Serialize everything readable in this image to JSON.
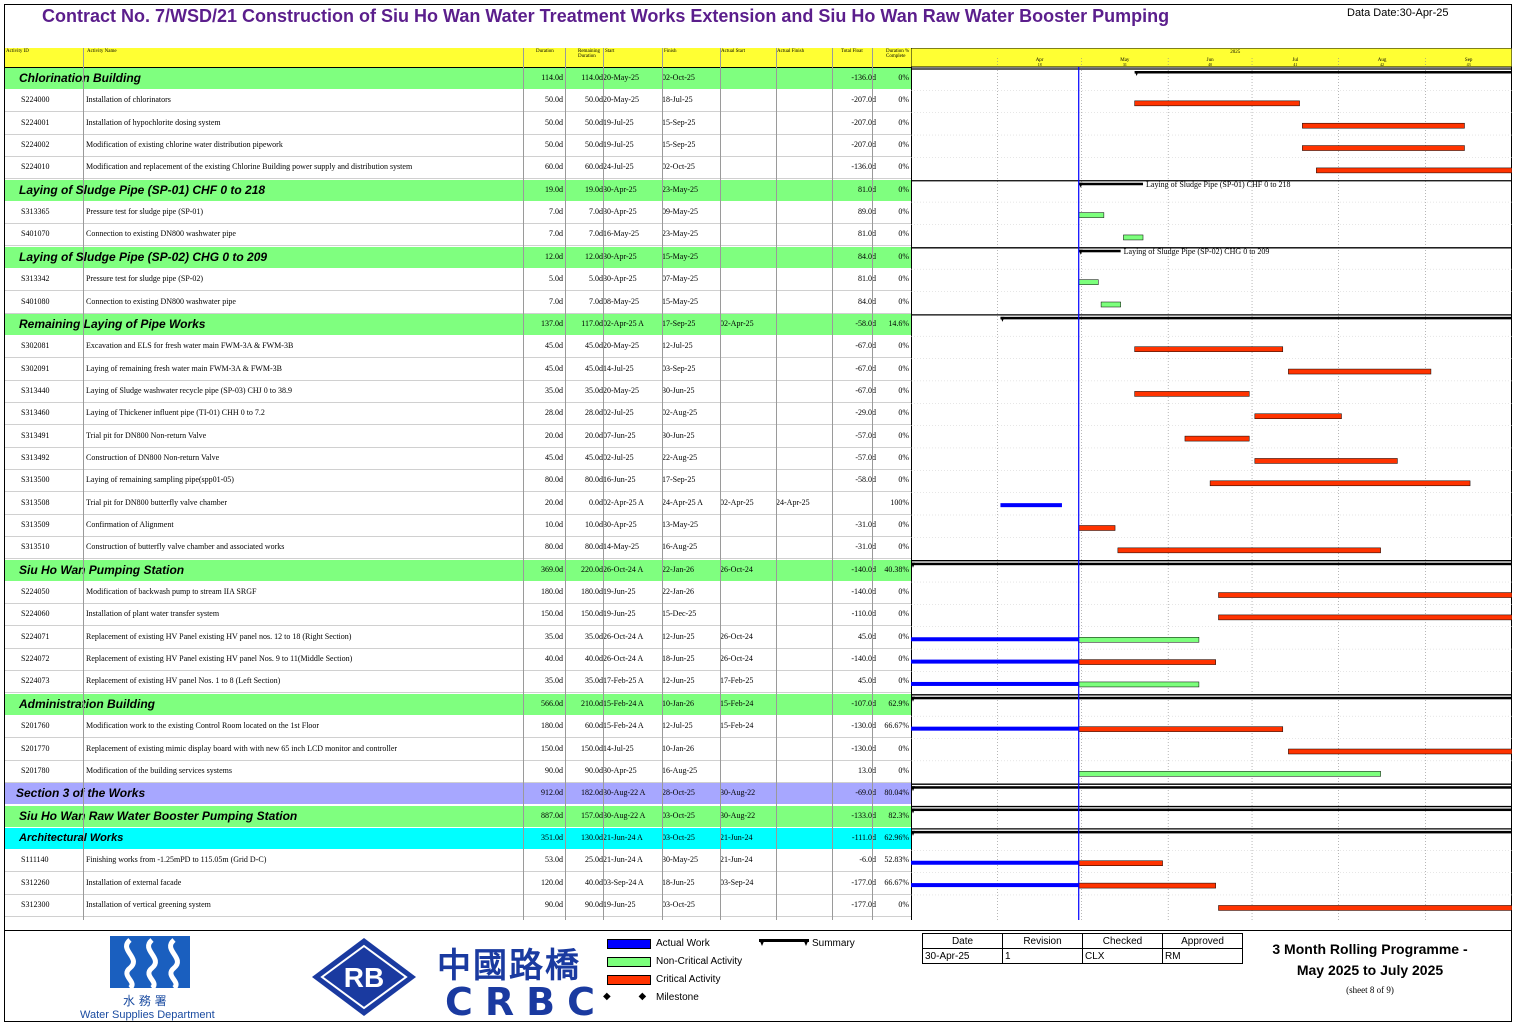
{
  "header": {
    "title": "Contract No. 7/WSD/21 Construction of Siu Ho Wan Water Treatment Works Extension and Siu Ho Wan Raw Water Booster Pumping",
    "data_date": "Data Date:30-Apr-25"
  },
  "columns": {
    "id": "Activity ID",
    "name": "Activity Name",
    "dur": "Duration",
    "rem": "Remaining Duration",
    "start": "Start",
    "finish": "Finish",
    "as": "Actual Start",
    "af": "Actual Finish",
    "tf": "Total Float",
    "pct": "Duration % Complete"
  },
  "timescale": {
    "year": "2025",
    "months": [
      "Apr",
      "May",
      "Jun",
      "Jul",
      "Aug",
      "Sep"
    ],
    "weeks": [
      "18",
      "31",
      "40",
      "41",
      "42",
      "43"
    ]
  },
  "rows": [
    {
      "type": "sum",
      "name": "Chlorination Building",
      "dur": "114.0d",
      "rem": "114.0d",
      "start": "20-May-25",
      "finish": "02-Oct-25",
      "as": "",
      "af": "",
      "tf": "-136.0d",
      "pct": "0%",
      "bars": [
        {
          "k": "summary",
          "s": "2025-05-20",
          "e": "2025-10-02"
        }
      ]
    },
    {
      "type": "act",
      "id": "S224000",
      "name": "Installation of chlorinators",
      "dur": "50.0d",
      "rem": "50.0d",
      "start": "20-May-25",
      "finish": "18-Jul-25",
      "as": "",
      "af": "",
      "tf": "-207.0d",
      "pct": "0%",
      "bars": [
        {
          "k": "critical",
          "s": "2025-05-20",
          "e": "2025-07-18"
        }
      ]
    },
    {
      "type": "act",
      "id": "S224001",
      "name": "Installation of hypochlorite dosing system",
      "dur": "50.0d",
      "rem": "50.0d",
      "start": "19-Jul-25",
      "finish": "15-Sep-25",
      "as": "",
      "af": "",
      "tf": "-207.0d",
      "pct": "0%",
      "bars": [
        {
          "k": "critical",
          "s": "2025-07-19",
          "e": "2025-09-15"
        }
      ]
    },
    {
      "type": "act",
      "id": "S224002",
      "name": "Modification of existing chlorine water distribution pipework",
      "dur": "50.0d",
      "rem": "50.0d",
      "start": "19-Jul-25",
      "finish": "15-Sep-25",
      "as": "",
      "af": "",
      "tf": "-207.0d",
      "pct": "0%",
      "bars": [
        {
          "k": "critical",
          "s": "2025-07-19",
          "e": "2025-09-15"
        }
      ]
    },
    {
      "type": "act",
      "id": "S224010",
      "name": "Modification and replacement of the existing Chlorine Building power supply and distribution system",
      "dur": "60.0d",
      "rem": "60.0d",
      "start": "24-Jul-25",
      "finish": "02-Oct-25",
      "as": "",
      "af": "",
      "tf": "-136.0d",
      "pct": "0%",
      "bars": [
        {
          "k": "critical",
          "s": "2025-07-24",
          "e": "2025-10-02"
        }
      ]
    },
    {
      "type": "sum",
      "name": "Laying of Sludge Pipe (SP-01) CHF 0  to 218",
      "dur": "19.0d",
      "rem": "19.0d",
      "start": "30-Apr-25",
      "finish": "23-May-25",
      "as": "",
      "af": "",
      "tf": "81.0d",
      "pct": "0%",
      "label": "Laying of Sludge Pipe (SP-01) CHF 0  to 218",
      "bars": [
        {
          "k": "summary",
          "s": "2025-04-30",
          "e": "2025-05-23"
        }
      ]
    },
    {
      "type": "act",
      "id": "S313365",
      "name": "Pressure test for sludge pipe (SP-01)",
      "dur": "7.0d",
      "rem": "7.0d",
      "start": "30-Apr-25",
      "finish": "09-May-25",
      "as": "",
      "af": "",
      "tf": "89.0d",
      "pct": "0%",
      "bars": [
        {
          "k": "noncritical",
          "s": "2025-04-30",
          "e": "2025-05-09"
        }
      ]
    },
    {
      "type": "act",
      "id": "S401070",
      "name": "Connection to existing DN800 washwater pipe",
      "dur": "7.0d",
      "rem": "7.0d",
      "start": "16-May-25",
      "finish": "23-May-25",
      "as": "",
      "af": "",
      "tf": "81.0d",
      "pct": "0%",
      "bars": [
        {
          "k": "noncritical",
          "s": "2025-05-16",
          "e": "2025-05-23"
        }
      ]
    },
    {
      "type": "sum",
      "name": "Laying of Sludge Pipe (SP-02) CHG 0  to 209",
      "dur": "12.0d",
      "rem": "12.0d",
      "start": "30-Apr-25",
      "finish": "15-May-25",
      "as": "",
      "af": "",
      "tf": "84.0d",
      "pct": "0%",
      "label": "Laying of Sludge Pipe (SP-02) CHG 0  to 209",
      "bars": [
        {
          "k": "summary",
          "s": "2025-04-30",
          "e": "2025-05-15"
        }
      ]
    },
    {
      "type": "act",
      "id": "S313342",
      "name": "Pressure test for sludge pipe (SP-02)",
      "dur": "5.0d",
      "rem": "5.0d",
      "start": "30-Apr-25",
      "finish": "07-May-25",
      "as": "",
      "af": "",
      "tf": "81.0d",
      "pct": "0%",
      "bars": [
        {
          "k": "noncritical",
          "s": "2025-04-30",
          "e": "2025-05-07"
        }
      ]
    },
    {
      "type": "act",
      "id": "S401080",
      "name": "Connection to existing DN800 washwater pipe",
      "dur": "7.0d",
      "rem": "7.0d",
      "start": "08-May-25",
      "finish": "15-May-25",
      "as": "",
      "af": "",
      "tf": "84.0d",
      "pct": "0%",
      "bars": [
        {
          "k": "noncritical",
          "s": "2025-05-08",
          "e": "2025-05-15"
        }
      ]
    },
    {
      "type": "sum",
      "name": "Remaining Laying of Pipe Works",
      "dur": "137.0d",
      "rem": "117.0d",
      "start": "02-Apr-25 A",
      "finish": "17-Sep-25",
      "as": "02-Apr-25",
      "af": "",
      "tf": "-58.0d",
      "pct": "14.6%",
      "bars": [
        {
          "k": "summary",
          "s": "2025-04-02",
          "e": "2025-10-02"
        }
      ]
    },
    {
      "type": "act",
      "id": "S302081",
      "name": "Excavation and ELS for fresh water main FWM-3A & FWM-3B",
      "dur": "45.0d",
      "rem": "45.0d",
      "start": "20-May-25",
      "finish": "12-Jul-25",
      "as": "",
      "af": "",
      "tf": "-67.0d",
      "pct": "0%",
      "bars": [
        {
          "k": "critical",
          "s": "2025-05-20",
          "e": "2025-07-12"
        }
      ]
    },
    {
      "type": "act",
      "id": "S302091",
      "name": "Laying of remaining fresh water main FWM-3A & FWM-3B",
      "dur": "45.0d",
      "rem": "45.0d",
      "start": "14-Jul-25",
      "finish": "03-Sep-25",
      "as": "",
      "af": "",
      "tf": "-67.0d",
      "pct": "0%",
      "bars": [
        {
          "k": "critical",
          "s": "2025-07-14",
          "e": "2025-09-03"
        }
      ]
    },
    {
      "type": "act",
      "id": "S313440",
      "name": "Laying of Sludge washwater recycle pipe (SP-03) CHJ 0 to 38.9",
      "dur": "35.0d",
      "rem": "35.0d",
      "start": "20-May-25",
      "finish": "30-Jun-25",
      "as": "",
      "af": "",
      "tf": "-67.0d",
      "pct": "0%",
      "bars": [
        {
          "k": "critical",
          "s": "2025-05-20",
          "e": "2025-06-30"
        }
      ]
    },
    {
      "type": "act",
      "id": "S313460",
      "name": "Laying of Thickener influent pipe (TI-01) CHH 0 to 7.2",
      "dur": "28.0d",
      "rem": "28.0d",
      "start": "02-Jul-25",
      "finish": "02-Aug-25",
      "as": "",
      "af": "",
      "tf": "-29.0d",
      "pct": "0%",
      "bars": [
        {
          "k": "critical",
          "s": "2025-07-02",
          "e": "2025-08-02"
        }
      ]
    },
    {
      "type": "act",
      "id": "S313491",
      "name": "Trial pit for DN800 Non-return Valve",
      "dur": "20.0d",
      "rem": "20.0d",
      "start": "07-Jun-25",
      "finish": "30-Jun-25",
      "as": "",
      "af": "",
      "tf": "-57.0d",
      "pct": "0%",
      "bars": [
        {
          "k": "critical",
          "s": "2025-06-07",
          "e": "2025-06-30"
        }
      ]
    },
    {
      "type": "act",
      "id": "S313492",
      "name": "Construction of DN800 Non-return Valve",
      "dur": "45.0d",
      "rem": "45.0d",
      "start": "02-Jul-25",
      "finish": "22-Aug-25",
      "as": "",
      "af": "",
      "tf": "-57.0d",
      "pct": "0%",
      "bars": [
        {
          "k": "critical",
          "s": "2025-07-02",
          "e": "2025-08-22"
        }
      ]
    },
    {
      "type": "act",
      "id": "S313500",
      "name": "Laying of remaining sampling pipe(spp01-05)",
      "dur": "80.0d",
      "rem": "80.0d",
      "start": "16-Jun-25",
      "finish": "17-Sep-25",
      "as": "",
      "af": "",
      "tf": "-58.0d",
      "pct": "0%",
      "bars": [
        {
          "k": "critical",
          "s": "2025-06-16",
          "e": "2025-09-17"
        }
      ]
    },
    {
      "type": "act",
      "id": "S313508",
      "name": "Trial pit for DN800 butterfly valve chamber",
      "dur": "20.0d",
      "rem": "0.0d",
      "start": "02-Apr-25 A",
      "finish": "24-Apr-25 A",
      "as": "02-Apr-25",
      "af": "24-Apr-25",
      "tf": "",
      "pct": "100%",
      "bars": [
        {
          "k": "actual",
          "s": "2025-04-02",
          "e": "2025-04-24"
        }
      ]
    },
    {
      "type": "act",
      "id": "S313509",
      "name": "Confirmation of Alignment",
      "dur": "10.0d",
      "rem": "10.0d",
      "start": "30-Apr-25",
      "finish": "13-May-25",
      "as": "",
      "af": "",
      "tf": "-31.0d",
      "pct": "0%",
      "bars": [
        {
          "k": "critical",
          "s": "2025-04-30",
          "e": "2025-05-13"
        }
      ]
    },
    {
      "type": "act",
      "id": "S313510",
      "name": "Construction of butterfly valve chamber and associated works",
      "dur": "80.0d",
      "rem": "80.0d",
      "start": "14-May-25",
      "finish": "16-Aug-25",
      "as": "",
      "af": "",
      "tf": "-31.0d",
      "pct": "0%",
      "bars": [
        {
          "k": "critical",
          "s": "2025-05-14",
          "e": "2025-08-16"
        }
      ]
    },
    {
      "type": "sum",
      "name": "Siu Ho Wan Pumping Station",
      "dur": "369.0d",
      "rem": "220.0d",
      "start": "26-Oct-24 A",
      "finish": "22-Jan-26",
      "as": "26-Oct-24",
      "af": "",
      "tf": "-140.0d",
      "pct": "40.38%",
      "bars": [
        {
          "k": "summary",
          "s": "2025-03-01",
          "e": "2025-10-02"
        }
      ]
    },
    {
      "type": "act",
      "id": "S224050",
      "name": "Modification of backwash pump to stream IIA SRGF",
      "dur": "180.0d",
      "rem": "180.0d",
      "start": "19-Jun-25",
      "finish": "22-Jan-26",
      "as": "",
      "af": "",
      "tf": "-140.0d",
      "pct": "0%",
      "bars": [
        {
          "k": "critical",
          "s": "2025-06-19",
          "e": "2025-10-02"
        }
      ]
    },
    {
      "type": "act",
      "id": "S224060",
      "name": "Installation of plant water transfer system",
      "dur": "150.0d",
      "rem": "150.0d",
      "start": "19-Jun-25",
      "finish": "15-Dec-25",
      "as": "",
      "af": "",
      "tf": "-110.0d",
      "pct": "0%",
      "bars": [
        {
          "k": "critical",
          "s": "2025-06-19",
          "e": "2025-10-02"
        }
      ]
    },
    {
      "type": "act",
      "id": "S224071",
      "name": "Replacement of existing HV Panel existing HV panel nos. 12 to 18 (Right Section)",
      "dur": "35.0d",
      "rem": "35.0d",
      "start": "26-Oct-24 A",
      "finish": "12-Jun-25",
      "as": "26-Oct-24",
      "af": "",
      "tf": "45.0d",
      "pct": "0%",
      "bars": [
        {
          "k": "actual",
          "s": "2025-03-01",
          "e": "2025-04-30"
        },
        {
          "k": "noncritical",
          "s": "2025-04-30",
          "e": "2025-06-12"
        }
      ]
    },
    {
      "type": "act",
      "id": "S224072",
      "name": "Replacement of existing HV Panel existing HV panel Nos. 9 to 11(Middle Section)",
      "dur": "40.0d",
      "rem": "40.0d",
      "start": "26-Oct-24 A",
      "finish": "18-Jun-25",
      "as": "26-Oct-24",
      "af": "",
      "tf": "-140.0d",
      "pct": "0%",
      "bars": [
        {
          "k": "actual",
          "s": "2025-03-01",
          "e": "2025-04-30"
        },
        {
          "k": "critical",
          "s": "2025-04-30",
          "e": "2025-06-18"
        }
      ]
    },
    {
      "type": "act",
      "id": "S224073",
      "name": "Replacement of existing HV panel Nos. 1 to 8 (Left Section)",
      "dur": "35.0d",
      "rem": "35.0d",
      "start": "17-Feb-25 A",
      "finish": "12-Jun-25",
      "as": "17-Feb-25",
      "af": "",
      "tf": "45.0d",
      "pct": "0%",
      "bars": [
        {
          "k": "actual",
          "s": "2025-03-01",
          "e": "2025-04-30"
        },
        {
          "k": "noncritical",
          "s": "2025-04-30",
          "e": "2025-06-12"
        }
      ]
    },
    {
      "type": "sum",
      "name": "Administration Building",
      "dur": "566.0d",
      "rem": "210.0d",
      "start": "15-Feb-24 A",
      "finish": "10-Jan-26",
      "as": "15-Feb-24",
      "af": "",
      "tf": "-107.0d",
      "pct": "62.9%",
      "bars": [
        {
          "k": "summary",
          "s": "2025-03-01",
          "e": "2025-10-02"
        }
      ]
    },
    {
      "type": "act",
      "id": "S201760",
      "name": "Modification work to the existing Control Room located on the 1st Floor",
      "dur": "180.0d",
      "rem": "60.0d",
      "start": "15-Feb-24 A",
      "finish": "12-Jul-25",
      "as": "15-Feb-24",
      "af": "",
      "tf": "-130.0d",
      "pct": "66.67%",
      "bars": [
        {
          "k": "actual",
          "s": "2025-03-01",
          "e": "2025-04-30"
        },
        {
          "k": "critical",
          "s": "2025-04-30",
          "e": "2025-07-12"
        }
      ]
    },
    {
      "type": "act",
      "id": "S201770",
      "name": "Replacement of existing mimic display board with with new 65 inch LCD monitor and controller",
      "dur": "150.0d",
      "rem": "150.0d",
      "start": "14-Jul-25",
      "finish": "10-Jan-26",
      "as": "",
      "af": "",
      "tf": "-130.0d",
      "pct": "0%",
      "bars": [
        {
          "k": "critical",
          "s": "2025-07-14",
          "e": "2025-10-02"
        }
      ]
    },
    {
      "type": "act",
      "id": "S201780",
      "name": "Modification of the building services systems",
      "dur": "90.0d",
      "rem": "90.0d",
      "start": "30-Apr-25",
      "finish": "16-Aug-25",
      "as": "",
      "af": "",
      "tf": "13.0d",
      "pct": "0%",
      "bars": [
        {
          "k": "noncritical",
          "s": "2025-04-30",
          "e": "2025-08-16"
        }
      ]
    },
    {
      "type": "sec",
      "name": "Section 3 of the Works",
      "dur": "912.0d",
      "rem": "182.0d",
      "start": "30-Aug-22 A",
      "finish": "28-Oct-25",
      "as": "30-Aug-22",
      "af": "",
      "tf": "-69.0d",
      "pct": "80.04%",
      "bars": [
        {
          "k": "summary",
          "s": "2025-03-01",
          "e": "2025-10-02"
        }
      ]
    },
    {
      "type": "sum",
      "name": "Siu Ho Wan Raw Water Booster Pumping Station",
      "dur": "887.0d",
      "rem": "157.0d",
      "start": "30-Aug-22 A",
      "finish": "03-Oct-25",
      "as": "30-Aug-22",
      "af": "",
      "tf": "-133.0d",
      "pct": "82.3%",
      "bars": [
        {
          "k": "summary",
          "s": "2025-03-01",
          "e": "2025-10-02"
        }
      ]
    },
    {
      "type": "sub",
      "name": "Architectural Works",
      "dur": "351.0d",
      "rem": "130.0d",
      "start": "21-Jun-24 A",
      "finish": "03-Oct-25",
      "as": "21-Jun-24",
      "af": "",
      "tf": "-111.0d",
      "pct": "62.96%",
      "bars": [
        {
          "k": "summary",
          "s": "2025-03-01",
          "e": "2025-10-02"
        }
      ]
    },
    {
      "type": "act",
      "id": "S111140",
      "name": "Finishing works from -1.25mPD to 115.05m (Grid D-C)",
      "dur": "53.0d",
      "rem": "25.0d",
      "start": "21-Jun-24 A",
      "finish": "30-May-25",
      "as": "21-Jun-24",
      "af": "",
      "tf": "-6.0d",
      "pct": "52.83%",
      "bars": [
        {
          "k": "actual",
          "s": "2025-03-01",
          "e": "2025-04-30"
        },
        {
          "k": "critical",
          "s": "2025-04-30",
          "e": "2025-05-30"
        }
      ]
    },
    {
      "type": "act",
      "id": "S312260",
      "name": "Installation of external facade",
      "dur": "120.0d",
      "rem": "40.0d",
      "start": "03-Sep-24 A",
      "finish": "18-Jun-25",
      "as": "03-Sep-24",
      "af": "",
      "tf": "-177.0d",
      "pct": "66.67%",
      "bars": [
        {
          "k": "actual",
          "s": "2025-03-01",
          "e": "2025-04-30"
        },
        {
          "k": "critical",
          "s": "2025-04-30",
          "e": "2025-06-18"
        }
      ]
    },
    {
      "type": "act",
      "id": "S312300",
      "name": "Installation of vertical greening system",
      "dur": "90.0d",
      "rem": "90.0d",
      "start": "19-Jun-25",
      "finish": "03-Oct-25",
      "as": "",
      "af": "",
      "tf": "-177.0d",
      "pct": "0%",
      "bars": [
        {
          "k": "critical",
          "s": "2025-06-19",
          "e": "2025-10-02"
        }
      ]
    }
  ],
  "colors": {
    "summary_row": "#7fff7f",
    "section_row": "#a7a7ff",
    "subsection_row": "#00ffff",
    "header_yellow": "#ffff33",
    "actual": "#0000ff",
    "noncritical": "#7cff7c",
    "critical": "#ff3300",
    "data_date_line": "#0000ff",
    "title": "#5b1e8c"
  },
  "legend": {
    "actual": "Actual Work",
    "noncritical": "Non-Critical Activity",
    "critical": "Critical Activity",
    "milestone": "Milestone",
    "summary": "Summary"
  },
  "signoff": {
    "headers": [
      "Date",
      "Revision",
      "Checked",
      "Approved"
    ],
    "values": [
      "30-Apr-25",
      "1",
      "CLX",
      "RM"
    ]
  },
  "footer": {
    "programme_line1": "3 Month Rolling Programme -",
    "programme_line2": "May 2025 to July 2025",
    "sheet": "(sheet 8 of 9)",
    "wsd_name": "Water Supplies Department",
    "wsd_chinese": "水 務 署",
    "crbc_chinese": "中國路橋",
    "crbc_english": "CRBC",
    "rb_logo": "RB"
  }
}
